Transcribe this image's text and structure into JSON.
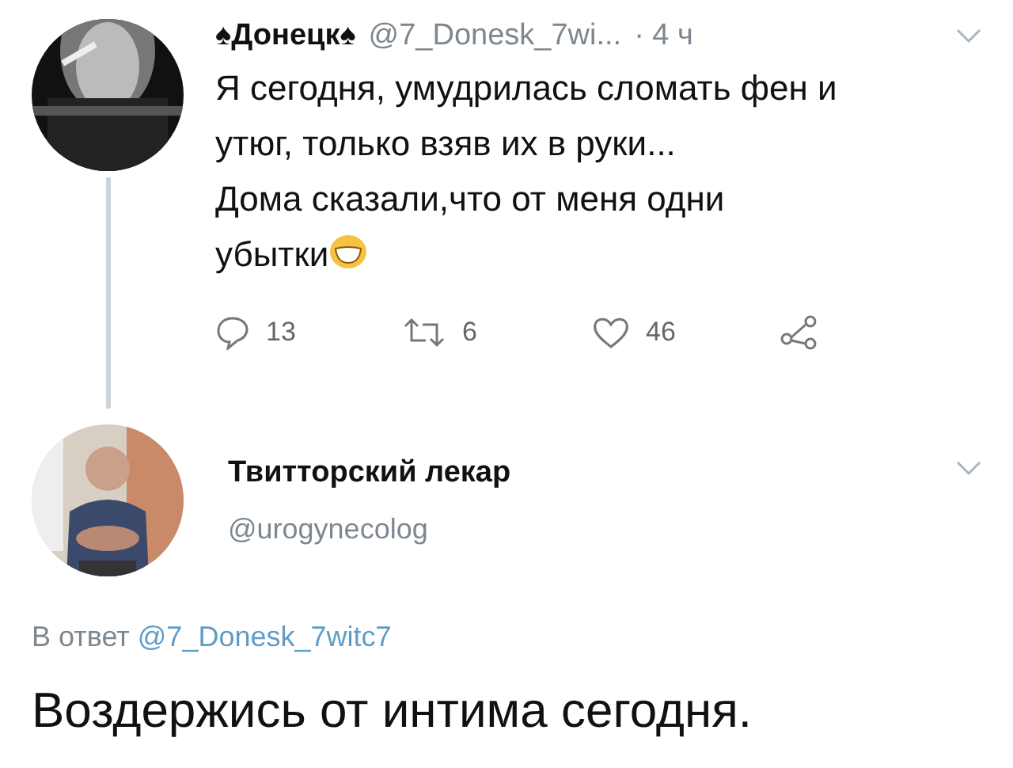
{
  "tweet": {
    "name": "♠Донецк♠",
    "handle": "@7_Donesk_7wi...",
    "time": "· 4 ч",
    "lines": [
      "Я сегодня, умудрилась сломать фен и",
      "утюг, только взяв их в руки...",
      "Дома сказали,что от меня одни",
      "убытки"
    ],
    "actions": [
      {
        "kind": "reply",
        "count": "13"
      },
      {
        "kind": "retweet",
        "count": "6"
      },
      {
        "kind": "like",
        "count": "46"
      },
      {
        "kind": "share"
      }
    ]
  },
  "reply": {
    "name": "Твитторский лекар",
    "handle": "@urogynecolog",
    "in_reply_prefix": "В ответ",
    "in_reply_to": "@7_Donesk_7witc7",
    "text": "Воздержись от интима сегодня."
  }
}
